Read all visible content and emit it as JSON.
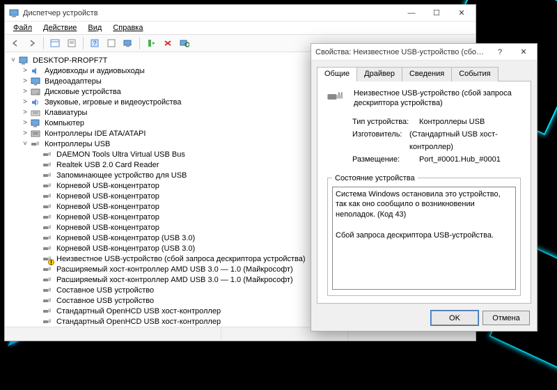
{
  "mainWindow": {
    "title": "Диспетчер устройств",
    "menu": [
      "Файл",
      "Действие",
      "Вид",
      "Справка"
    ],
    "root": "DESKTOP-RROPF7T",
    "categories": [
      {
        "icon": "audio",
        "label": "Аудиовходы и аудиовыходы"
      },
      {
        "icon": "display",
        "label": "Видеоадаптеры"
      },
      {
        "icon": "disk",
        "label": "Дисковые устройства"
      },
      {
        "icon": "sound",
        "label": "Звуковые, игровые и видеоустройства"
      },
      {
        "icon": "keyboard",
        "label": "Клавиатуры"
      },
      {
        "icon": "computer",
        "label": "Компьютер"
      },
      {
        "icon": "ide",
        "label": "Контроллеры IDE ATA/ATAPI"
      }
    ],
    "usbCategory": "Контроллеры USB",
    "usbDevices": [
      {
        "icon": "usb",
        "label": "DAEMON Tools Ultra Virtual USB Bus"
      },
      {
        "icon": "usb",
        "label": "Realtek USB 2.0 Card Reader"
      },
      {
        "icon": "usb",
        "label": "Запоминающее устройство для USB"
      },
      {
        "icon": "usb",
        "label": "Корневой USB-концентратор"
      },
      {
        "icon": "usb",
        "label": "Корневой USB-концентратор"
      },
      {
        "icon": "usb",
        "label": "Корневой USB-концентратор"
      },
      {
        "icon": "usb",
        "label": "Корневой USB-концентратор"
      },
      {
        "icon": "usb",
        "label": "Корневой USB-концентратор"
      },
      {
        "icon": "usb",
        "label": "Корневой USB-концентратор (USB 3.0)"
      },
      {
        "icon": "usb",
        "label": "Корневой USB-концентратор (USB 3.0)"
      },
      {
        "icon": "usb",
        "warn": true,
        "label": "Неизвестное USB-устройство (сбой запроса дескриптора устройства)"
      },
      {
        "icon": "usb",
        "label": "Расширяемый хост-контроллер AMD USB 3.0 — 1.0 (Майкрософт)"
      },
      {
        "icon": "usb",
        "label": "Расширяемый хост-контроллер AMD USB 3.0 — 1.0 (Майкрософт)"
      },
      {
        "icon": "usb",
        "label": "Составное USB устройство"
      },
      {
        "icon": "usb",
        "label": "Составное USB устройство"
      },
      {
        "icon": "usb",
        "label": "Стандартный OpenHCD USB хост-контроллер"
      },
      {
        "icon": "usb",
        "label": "Стандартный OpenHCD USB хост-контроллер"
      }
    ]
  },
  "propWindow": {
    "title": "Свойства: Неизвестное USB-устройство (сбой запроса дескрип…",
    "tabs": [
      "Общие",
      "Драйвер",
      "Сведения",
      "События"
    ],
    "deviceName": "Неизвестное USB-устройство (сбой запроса дескриптора устройства)",
    "typeLabel": "Тип устройства:",
    "typeValue": "Контроллеры USB",
    "mfgLabel": "Изготовитель:",
    "mfgValue": "(Стандартный USB хост-контроллер)",
    "locLabel": "Размещение:",
    "locValue": "Port_#0001.Hub_#0001",
    "statusLegend": "Состояние устройства",
    "statusText": "Система Windows остановила это устройство, так как оно сообщило о возникновении неполадок. (Код 43)\n\nСбой запроса дескриптора USB-устройства.",
    "ok": "OK",
    "cancel": "Отмена"
  }
}
